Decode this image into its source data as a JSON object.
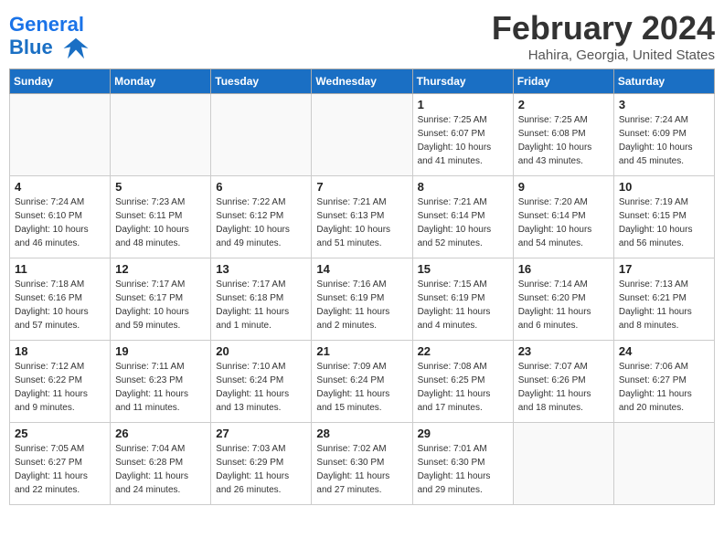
{
  "header": {
    "logo_line1": "General",
    "logo_line2": "Blue",
    "month": "February 2024",
    "location": "Hahira, Georgia, United States"
  },
  "days_of_week": [
    "Sunday",
    "Monday",
    "Tuesday",
    "Wednesday",
    "Thursday",
    "Friday",
    "Saturday"
  ],
  "weeks": [
    [
      {
        "day": "",
        "info": ""
      },
      {
        "day": "",
        "info": ""
      },
      {
        "day": "",
        "info": ""
      },
      {
        "day": "",
        "info": ""
      },
      {
        "day": "1",
        "info": "Sunrise: 7:25 AM\nSunset: 6:07 PM\nDaylight: 10 hours\nand 41 minutes."
      },
      {
        "day": "2",
        "info": "Sunrise: 7:25 AM\nSunset: 6:08 PM\nDaylight: 10 hours\nand 43 minutes."
      },
      {
        "day": "3",
        "info": "Sunrise: 7:24 AM\nSunset: 6:09 PM\nDaylight: 10 hours\nand 45 minutes."
      }
    ],
    [
      {
        "day": "4",
        "info": "Sunrise: 7:24 AM\nSunset: 6:10 PM\nDaylight: 10 hours\nand 46 minutes."
      },
      {
        "day": "5",
        "info": "Sunrise: 7:23 AM\nSunset: 6:11 PM\nDaylight: 10 hours\nand 48 minutes."
      },
      {
        "day": "6",
        "info": "Sunrise: 7:22 AM\nSunset: 6:12 PM\nDaylight: 10 hours\nand 49 minutes."
      },
      {
        "day": "7",
        "info": "Sunrise: 7:21 AM\nSunset: 6:13 PM\nDaylight: 10 hours\nand 51 minutes."
      },
      {
        "day": "8",
        "info": "Sunrise: 7:21 AM\nSunset: 6:14 PM\nDaylight: 10 hours\nand 52 minutes."
      },
      {
        "day": "9",
        "info": "Sunrise: 7:20 AM\nSunset: 6:14 PM\nDaylight: 10 hours\nand 54 minutes."
      },
      {
        "day": "10",
        "info": "Sunrise: 7:19 AM\nSunset: 6:15 PM\nDaylight: 10 hours\nand 56 minutes."
      }
    ],
    [
      {
        "day": "11",
        "info": "Sunrise: 7:18 AM\nSunset: 6:16 PM\nDaylight: 10 hours\nand 57 minutes."
      },
      {
        "day": "12",
        "info": "Sunrise: 7:17 AM\nSunset: 6:17 PM\nDaylight: 10 hours\nand 59 minutes."
      },
      {
        "day": "13",
        "info": "Sunrise: 7:17 AM\nSunset: 6:18 PM\nDaylight: 11 hours\nand 1 minute."
      },
      {
        "day": "14",
        "info": "Sunrise: 7:16 AM\nSunset: 6:19 PM\nDaylight: 11 hours\nand 2 minutes."
      },
      {
        "day": "15",
        "info": "Sunrise: 7:15 AM\nSunset: 6:19 PM\nDaylight: 11 hours\nand 4 minutes."
      },
      {
        "day": "16",
        "info": "Sunrise: 7:14 AM\nSunset: 6:20 PM\nDaylight: 11 hours\nand 6 minutes."
      },
      {
        "day": "17",
        "info": "Sunrise: 7:13 AM\nSunset: 6:21 PM\nDaylight: 11 hours\nand 8 minutes."
      }
    ],
    [
      {
        "day": "18",
        "info": "Sunrise: 7:12 AM\nSunset: 6:22 PM\nDaylight: 11 hours\nand 9 minutes."
      },
      {
        "day": "19",
        "info": "Sunrise: 7:11 AM\nSunset: 6:23 PM\nDaylight: 11 hours\nand 11 minutes."
      },
      {
        "day": "20",
        "info": "Sunrise: 7:10 AM\nSunset: 6:24 PM\nDaylight: 11 hours\nand 13 minutes."
      },
      {
        "day": "21",
        "info": "Sunrise: 7:09 AM\nSunset: 6:24 PM\nDaylight: 11 hours\nand 15 minutes."
      },
      {
        "day": "22",
        "info": "Sunrise: 7:08 AM\nSunset: 6:25 PM\nDaylight: 11 hours\nand 17 minutes."
      },
      {
        "day": "23",
        "info": "Sunrise: 7:07 AM\nSunset: 6:26 PM\nDaylight: 11 hours\nand 18 minutes."
      },
      {
        "day": "24",
        "info": "Sunrise: 7:06 AM\nSunset: 6:27 PM\nDaylight: 11 hours\nand 20 minutes."
      }
    ],
    [
      {
        "day": "25",
        "info": "Sunrise: 7:05 AM\nSunset: 6:27 PM\nDaylight: 11 hours\nand 22 minutes."
      },
      {
        "day": "26",
        "info": "Sunrise: 7:04 AM\nSunset: 6:28 PM\nDaylight: 11 hours\nand 24 minutes."
      },
      {
        "day": "27",
        "info": "Sunrise: 7:03 AM\nSunset: 6:29 PM\nDaylight: 11 hours\nand 26 minutes."
      },
      {
        "day": "28",
        "info": "Sunrise: 7:02 AM\nSunset: 6:30 PM\nDaylight: 11 hours\nand 27 minutes."
      },
      {
        "day": "29",
        "info": "Sunrise: 7:01 AM\nSunset: 6:30 PM\nDaylight: 11 hours\nand 29 minutes."
      },
      {
        "day": "",
        "info": ""
      },
      {
        "day": "",
        "info": ""
      }
    ]
  ]
}
